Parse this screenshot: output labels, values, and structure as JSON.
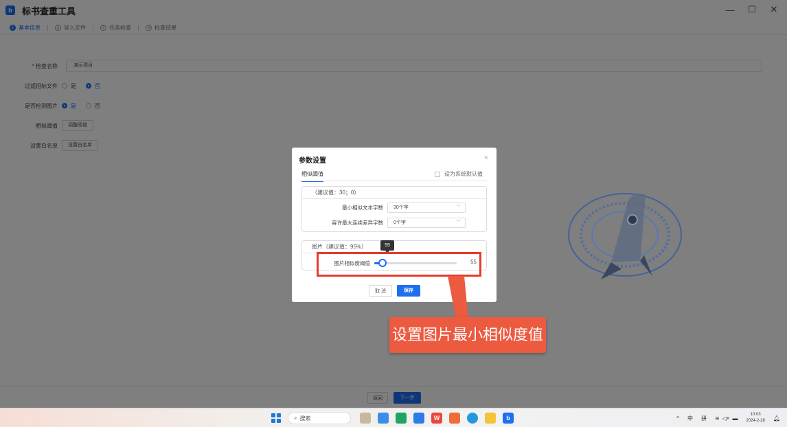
{
  "app": {
    "logo": "b",
    "title": "标书查重工具"
  },
  "window_controls": {
    "minimize": "—",
    "maximize": "☐",
    "close": "✕"
  },
  "steps": [
    {
      "num": "1",
      "label": "基本信息"
    },
    {
      "num": "2",
      "label": "导入文件"
    },
    {
      "num": "3",
      "label": "任务检查"
    },
    {
      "num": "4",
      "label": "检查结果"
    }
  ],
  "form": {
    "name_label": "* 检查名称",
    "name_value": "演示项目",
    "filter_label": "过滤招标文件",
    "filter_yes": "是",
    "filter_no": "否",
    "image_label": "是否检测图片",
    "image_yes": "是",
    "image_no": "否",
    "threshold_label": "相似阈值",
    "threshold_button": "调整阈值",
    "whitelist_label": "设置白名单",
    "whitelist_button": "设置白名单"
  },
  "footer": {
    "back": "返回",
    "next": "下一步"
  },
  "dialog": {
    "title": "参数设置",
    "close": "×",
    "tab": "相似阈值",
    "default_checkbox": "设为系统默认值",
    "text_box": {
      "header": "（建议值：30；0）",
      "min_label": "最小相似文本字数",
      "min_value": "30个字",
      "diff_label": "容许最大连续差异字数",
      "diff_value": "0个字"
    },
    "image_box": {
      "header": "图片（建议值：95%）",
      "slider_label": "图片相似度阈值",
      "slider_value": "55",
      "tooltip": "55",
      "slider_fraction": 0.1
    },
    "cancel": "取 消",
    "save": "保存"
  },
  "annotation": {
    "callout": "设置图片最小相似度值"
  },
  "taskbar": {
    "search": "搜索",
    "tray": {
      "chevron": "^",
      "ime1": "中",
      "ime2": "拼",
      "time": "10:03",
      "date": "2024-2-28"
    }
  },
  "colors": {
    "accent": "#1e6ef0",
    "highlight": "#e63a2e",
    "callout": "#ec5a40"
  }
}
